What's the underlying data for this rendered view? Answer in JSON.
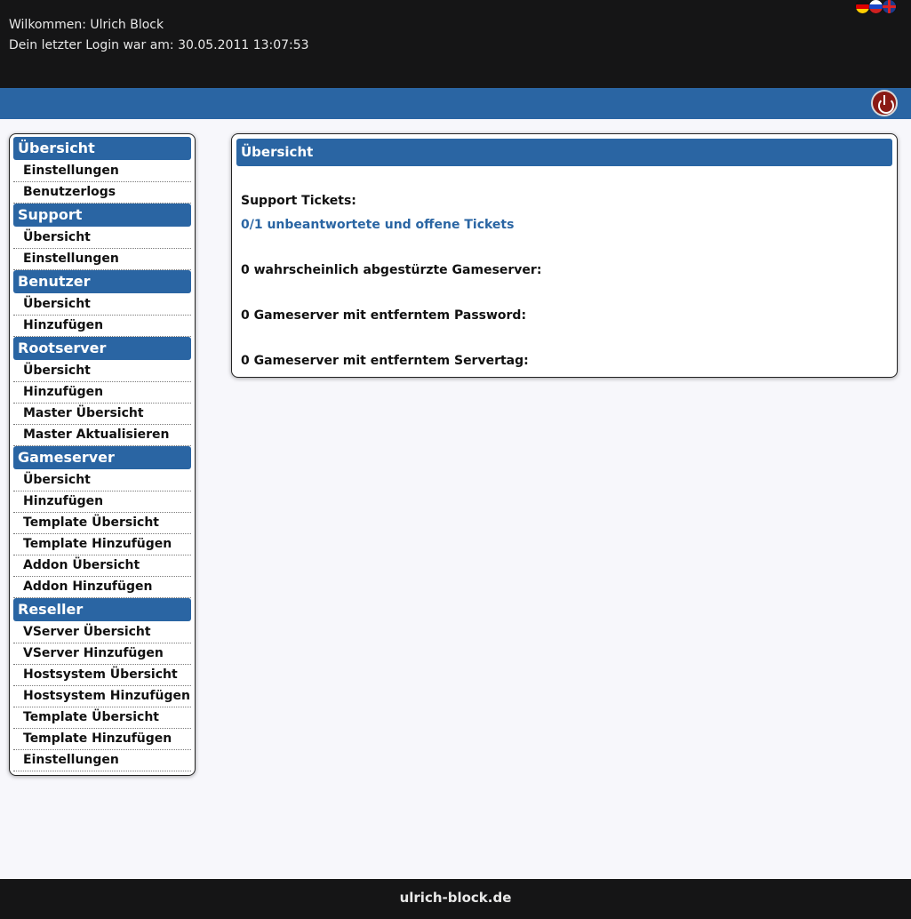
{
  "header": {
    "welcome": "Wilkommen: Ulrich Block",
    "last_login": "Dein letzter Login war am: 30.05.2011 13:07:53",
    "languages": [
      "de-flag-icon",
      "ru-flag-icon",
      "uk-flag-icon"
    ]
  },
  "toolbar": {
    "logout_icon": "power-icon"
  },
  "sidebar": {
    "sections": [
      {
        "title": "Übersicht",
        "items": [
          "Einstellungen",
          "Benutzerlogs"
        ]
      },
      {
        "title": "Support",
        "items": [
          "Übersicht",
          "Einstellungen"
        ]
      },
      {
        "title": "Benutzer",
        "items": [
          "Übersicht",
          "Hinzufügen"
        ]
      },
      {
        "title": "Rootserver",
        "items": [
          "Übersicht",
          "Hinzufügen",
          "Master Übersicht",
          "Master Aktualisieren"
        ]
      },
      {
        "title": "Gameserver",
        "items": [
          "Übersicht",
          "Hinzufügen",
          "Template Übersicht",
          "Template Hinzufügen",
          "Addon Übersicht",
          "Addon Hinzufügen"
        ]
      },
      {
        "title": "Reseller",
        "items": [
          "VServer Übersicht",
          "VServer Hinzufügen",
          "Hostsystem Übersicht",
          "Hostsystem Hinzufügen",
          "Template Übersicht",
          "Template Hinzufügen",
          "Einstellungen"
        ]
      }
    ]
  },
  "main": {
    "title": "Übersicht",
    "support_tickets_label": "Support Tickets:",
    "tickets_link": "0/1 unbeantwortete und offene Tickets",
    "crashed": "0 wahrscheinlich abgestürzte Gameserver:",
    "password_removed": "0 Gameserver mit entferntem Password:",
    "servertag_removed": "0 Gameserver mit entferntem Servertag:"
  },
  "footer": {
    "text": "ulrich-block.de"
  },
  "colors": {
    "accent": "#2a65a3",
    "dark": "#151516",
    "logout": "#8a1a14"
  }
}
